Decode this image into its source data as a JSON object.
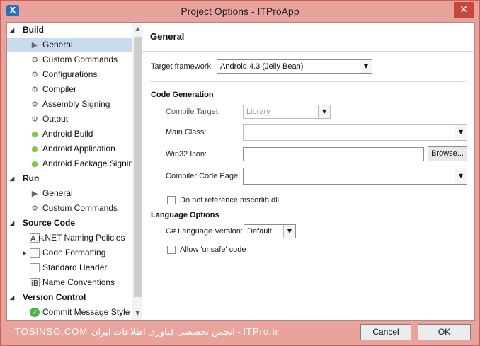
{
  "window": {
    "title": "Project Options - ITProApp",
    "close_label": "✕",
    "app_icon": "X"
  },
  "sidebar": {
    "build": {
      "label": "Build"
    },
    "build_items": [
      {
        "label": "General",
        "icon": "play-icon"
      },
      {
        "label": "Custom Commands",
        "icon": "gear-icon"
      },
      {
        "label": "Configurations",
        "icon": "gear-icon"
      },
      {
        "label": "Compiler",
        "icon": "gear-icon"
      },
      {
        "label": "Assembly Signing",
        "icon": "gear-icon"
      },
      {
        "label": "Output",
        "icon": "gear-icon"
      },
      {
        "label": "Android Build",
        "icon": "android-icon"
      },
      {
        "label": "Android Application",
        "icon": "android-icon"
      },
      {
        "label": "Android Package Signing",
        "icon": "android-icon"
      }
    ],
    "run": {
      "label": "Run"
    },
    "run_items": [
      {
        "label": "General",
        "icon": "play-icon"
      },
      {
        "label": "Custom Commands",
        "icon": "gear-icon"
      }
    ],
    "source": {
      "label": "Source Code"
    },
    "source_items": [
      {
        "label": ".NET Naming Policies",
        "icon": "naming-icon",
        "icon_text": "A.B"
      },
      {
        "label": "Code Formatting",
        "icon": "document-icon"
      },
      {
        "label": "Standard Header",
        "icon": "document-icon"
      },
      {
        "label": "Name Conventions",
        "icon": "naming-icon",
        "icon_text": "iB"
      }
    ],
    "vc": {
      "label": "Version Control"
    },
    "vc_items": [
      {
        "label": "Commit Message Style",
        "icon": "check-circle-icon"
      }
    ]
  },
  "main": {
    "title": "General",
    "target_framework": {
      "label": "Target framework:",
      "value": "Android 4.3 (Jelly Bean)"
    },
    "code_generation": {
      "heading": "Code Generation",
      "compile_target": {
        "label": "Compile Target:",
        "value": "Library"
      },
      "main_class": {
        "label": "Main Class:",
        "value": ""
      },
      "win32_icon": {
        "label": "Win32 Icon:",
        "value": "",
        "browse_label": "Browse..."
      },
      "compiler_code_page": {
        "label": "Compiler Code Page:",
        "value": ""
      },
      "no_mscorlib": {
        "label": "Do not reference mscorlib.dll",
        "checked": false
      }
    },
    "language_options": {
      "heading": "Language Options",
      "csharp_version": {
        "label": "C# Language Version:",
        "value": "Default"
      },
      "allow_unsafe": {
        "label": "Allow 'unsafe' code",
        "checked": false
      }
    }
  },
  "footer": {
    "watermark": "TOSINSO.COM   انجمن تخصصی فناوری اطلاعات ایران - ITPro.ir",
    "cancel_label": "Cancel",
    "ok_label": "OK"
  }
}
